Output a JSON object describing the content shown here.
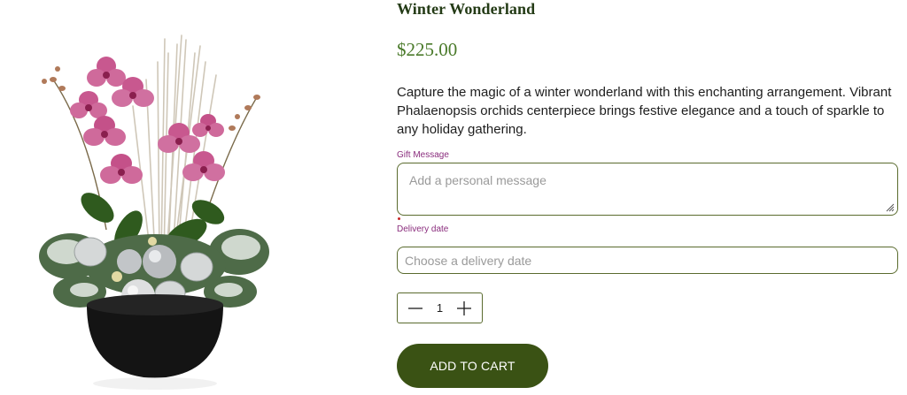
{
  "product": {
    "title": "Winter Wonderland",
    "price": "$225.00",
    "description": "Capture the magic of a winter wonderland with this enchanting arrangement. Vibrant Phalaenopsis orchids centerpiece brings festive elegance and a touch of sparkle to any holiday gathering.",
    "image_icon": "orchid-arrangement-image"
  },
  "form": {
    "gift_message": {
      "label": "Gift Message",
      "placeholder": "Add a personal message",
      "value": ""
    },
    "delivery_date": {
      "label": "Delivery date",
      "placeholder": "Choose a delivery date",
      "value": ""
    },
    "quantity": {
      "value": "1",
      "decrement_icon": "minus-icon",
      "increment_icon": "plus-icon"
    },
    "add_to_cart_label": "ADD TO CART"
  },
  "colors": {
    "brand_green": "#3a5214",
    "title_green": "#243b16",
    "price_green": "#4a7a2a",
    "label_magenta": "#8a2d7d",
    "border_olive": "#5a6b2e"
  }
}
